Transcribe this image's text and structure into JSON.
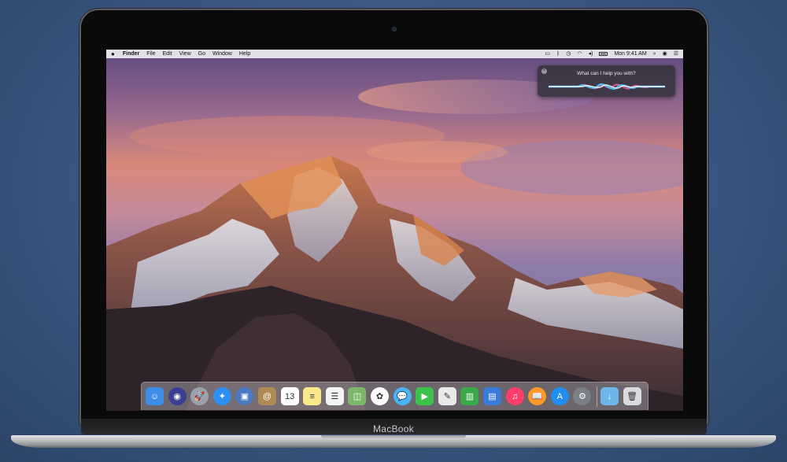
{
  "device": {
    "brand_label": "MacBook"
  },
  "menubar": {
    "apple_icon": "apple-icon",
    "app_name": "Finder",
    "menus": [
      "File",
      "Edit",
      "View",
      "Go",
      "Window",
      "Help"
    ],
    "clock": "Mon 9:41 AM",
    "status_icons": [
      "airplay-icon",
      "bluetooth-icon",
      "time-machine-icon",
      "wifi-icon",
      "volume-icon",
      "battery-icon",
      "search-icon",
      "siri-icon",
      "list-icon"
    ]
  },
  "siri": {
    "prompt": "What can I help you with?",
    "close_glyph": "×"
  },
  "dock": {
    "items": [
      {
        "name": "finder",
        "glyph": "☺",
        "bg": "#3d8ee8"
      },
      {
        "name": "siri",
        "glyph": "◉",
        "bg": "#3b3f8f"
      },
      {
        "name": "launchpad",
        "glyph": "🚀",
        "bg": "#9aa3ad"
      },
      {
        "name": "safari",
        "glyph": "✦",
        "bg": "#2d8ff0"
      },
      {
        "name": "preview",
        "glyph": "▣",
        "bg": "#4b79c2"
      },
      {
        "name": "contacts",
        "glyph": "@",
        "bg": "#b08a55"
      },
      {
        "name": "calendar",
        "glyph": "13",
        "bg": "#ffffff"
      },
      {
        "name": "notes",
        "glyph": "≡",
        "bg": "#fbe88a"
      },
      {
        "name": "reminders",
        "glyph": "☰",
        "bg": "#f4f4f4"
      },
      {
        "name": "photo-booth",
        "glyph": "◫",
        "bg": "#7db86a"
      },
      {
        "name": "photos",
        "glyph": "✿",
        "bg": "#ffffff"
      },
      {
        "name": "messages",
        "glyph": "💬",
        "bg": "#4ab3f5"
      },
      {
        "name": "facetime",
        "glyph": "▶",
        "bg": "#3cc24a"
      },
      {
        "name": "textedit",
        "glyph": "✎",
        "bg": "#e9e9e9"
      },
      {
        "name": "numbers",
        "glyph": "▥",
        "bg": "#3aa94a"
      },
      {
        "name": "keynote",
        "glyph": "▤",
        "bg": "#3a7ad8"
      },
      {
        "name": "itunes",
        "glyph": "♫",
        "bg": "#ff3e6c"
      },
      {
        "name": "ibooks",
        "glyph": "📖",
        "bg": "#ff9a2a"
      },
      {
        "name": "app-store",
        "glyph": "A",
        "bg": "#1f8ef0"
      },
      {
        "name": "system-preferences",
        "glyph": "⚙",
        "bg": "#7b7f86"
      },
      {
        "name": "downloads-folder",
        "glyph": "↓",
        "bg": "#6cb6ea"
      },
      {
        "name": "trash",
        "glyph": "🗑",
        "bg": "#d9dadd"
      }
    ]
  }
}
